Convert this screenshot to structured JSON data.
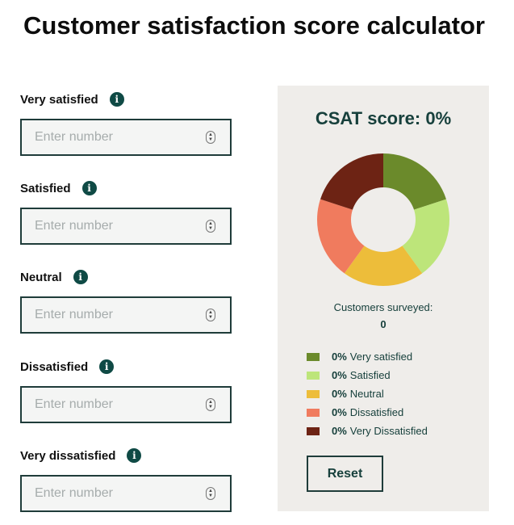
{
  "title": "Customer satisfaction score calculator",
  "fields": [
    {
      "label": "Very satisfied",
      "placeholder": "Enter number",
      "value": ""
    },
    {
      "label": "Satisfied",
      "placeholder": "Enter number",
      "value": ""
    },
    {
      "label": "Neutral",
      "placeholder": "Enter number",
      "value": ""
    },
    {
      "label": "Dissatisfied",
      "placeholder": "Enter number",
      "value": ""
    },
    {
      "label": "Very dissatisfied",
      "placeholder": "Enter number",
      "value": ""
    }
  ],
  "info_icon": {
    "icon": "info-icon",
    "glyph": "i"
  },
  "stepper_icon": {
    "icon": "stepper-icon",
    "up": "▲",
    "down": "▼"
  },
  "result": {
    "score_heading": "CSAT score: 0%",
    "surveyed_label": "Customers surveyed:",
    "surveyed_value": "0",
    "legend": [
      {
        "pct": "0%",
        "label": "Very satisfied",
        "color": "#6b8a2b"
      },
      {
        "pct": "0%",
        "label": "Satisfied",
        "color": "#bde57a"
      },
      {
        "pct": "0%",
        "label": "Neutral",
        "color": "#edbd3a"
      },
      {
        "pct": "0%",
        "label": "Dissatisfied",
        "color": "#f07b5e"
      },
      {
        "pct": "0%",
        "label": "Very Dissatisfied",
        "color": "#6d2314"
      }
    ],
    "donut_shares": [
      1,
      1,
      1,
      1,
      1
    ],
    "reset_label": "Reset"
  }
}
